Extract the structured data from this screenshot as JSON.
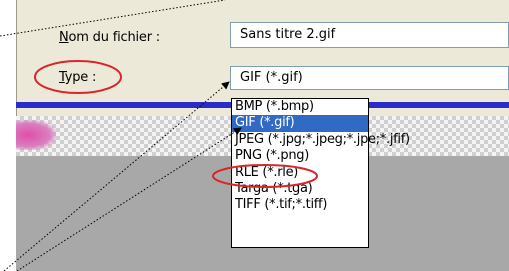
{
  "dialog": {
    "filename_label": {
      "accel": "N",
      "rest": "om du fichier :"
    },
    "filename_value": "Sans titre 2.gif",
    "type_label": {
      "accel": "T",
      "rest": "ype :"
    },
    "type_value": "GIF (*.gif)",
    "type_options": [
      "BMP (*.bmp)",
      "GIF (*.gif)",
      "JPEG (*.jpg;*.jpeg;*.jpe;*.jfif)",
      "PNG (*.png)",
      "RLE (*.rle)",
      "Targa (*.tga)",
      "TIFF (*.tif;*.tiff)"
    ],
    "selected_option": "GIF (*.gif)"
  },
  "colors": {
    "dialog_bg": "#ece9d8",
    "selection": "#316ac5",
    "annotation_red": "#d9262b",
    "field_border": "#7f9db9"
  }
}
